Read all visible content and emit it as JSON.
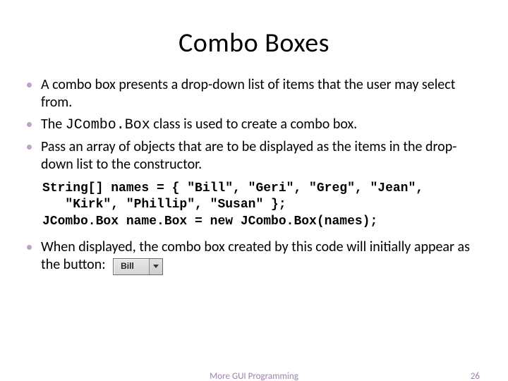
{
  "title": "Combo Boxes",
  "bullets": {
    "b1": "A combo box presents a drop-down list of items that the user may select from.",
    "b2_pre": "The ",
    "b2_code": "JCombo.Box",
    "b2_post": " class is used to create a combo box.",
    "b3": "Pass an array of objects that are to be displayed as the items in the drop-down list to the constructor.",
    "b4": "When displayed, the combo box created by this code will initially appear as the button:"
  },
  "code": "String[] names = { \"Bill\", \"Geri\", \"Greg\", \"Jean\",\n   \"Kirk\", \"Phillip\", \"Susan\" };\nJCombo.Box name.Box = new JCombo.Box(names);",
  "combo_value": "Bill",
  "footer_text": "More GUI Programming",
  "page_number": "26"
}
